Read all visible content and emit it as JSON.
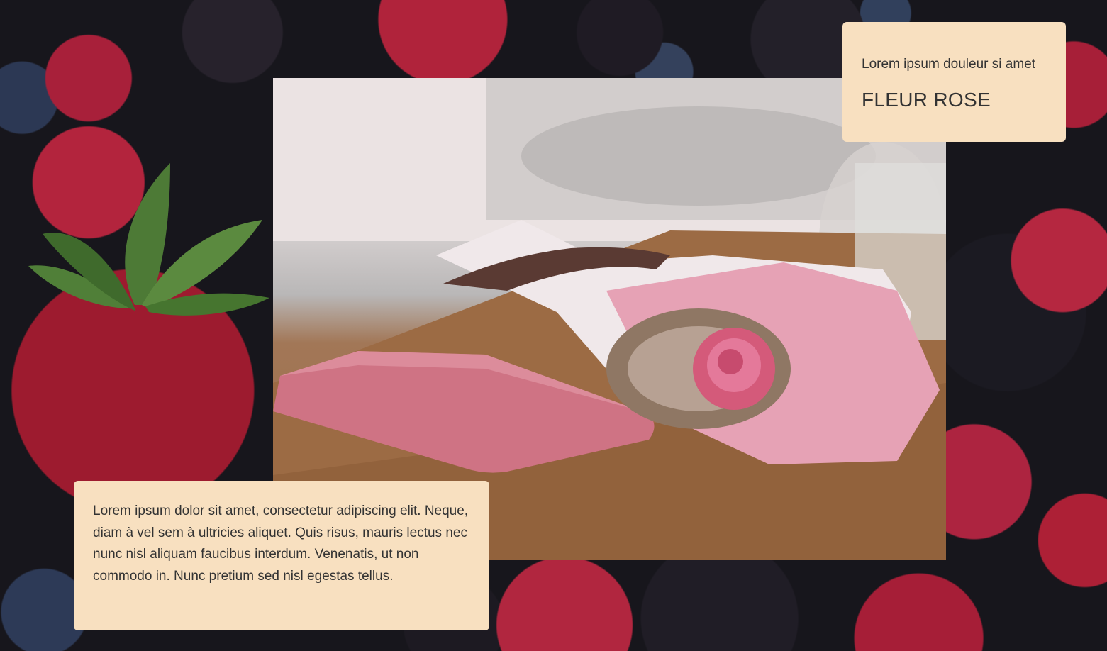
{
  "hero_card": {
    "subtitle": "Lorem ipsum douleur si amet",
    "title": "FLEUR ROSE"
  },
  "description_card": {
    "text": "Lorem ipsum dolor sit amet, consectetur adipiscing elit. Neque, diam à vel sem à ultricies aliquet. Quis risus, mauris lectus nec nunc nisl aliquam faucibus interdum. Venenatis, ut non commodo in. Nunc pretium sed nisl egestas tellus."
  },
  "colors": {
    "card_background": "#f8e0c0",
    "text": "#333333"
  }
}
